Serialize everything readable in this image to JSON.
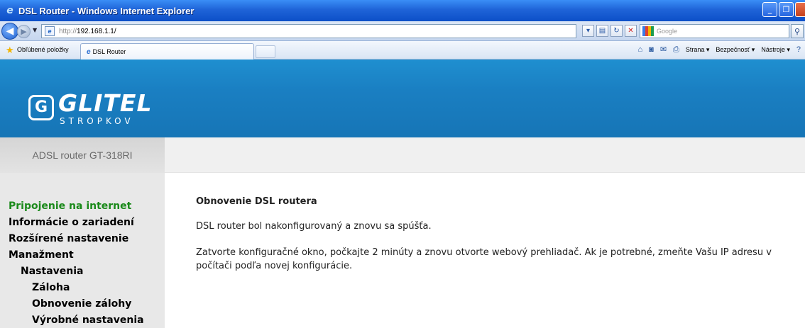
{
  "window": {
    "title": "DSL Router - Windows Internet Explorer"
  },
  "addressbar": {
    "url_protocol": "http://",
    "url_host": "192.168.1.1/",
    "search_placeholder": "Google"
  },
  "favbar": {
    "favorites_label": "Obľúbené položky",
    "tab_label": "DSL Router",
    "commands": [
      "Strana ▾",
      "Bezpečnosť ▾",
      "Nástroje ▾"
    ]
  },
  "banner": {
    "logo_mark": "G",
    "logo_text": "GLITEL",
    "logo_sub": "STROPKOV"
  },
  "model": {
    "label": "ADSL router GT-318RI"
  },
  "menu": {
    "items": [
      {
        "label": "Pripojenie na internet"
      },
      {
        "label": "Informácie o zariadení"
      },
      {
        "label": "Rozšírené nastavenie"
      },
      {
        "label": "Manažment"
      },
      {
        "label": "Nastavenia"
      },
      {
        "label": "Záloha"
      },
      {
        "label": "Obnovenie zálohy"
      },
      {
        "label": "Výrobné nastavenia"
      }
    ]
  },
  "main": {
    "heading": "Obnovenie DSL routera",
    "paragraph1": "DSL router bol nakonfigurovaný a znovu sa spúšťa.",
    "paragraph2": "Zatvorte konfiguračné okno, počkajte 2 minúty a znovu otvorte webový prehliadač. Ak je potrebné, zmeňte Vašu IP adresu v počítači podľa novej konfigurácie."
  },
  "colors": {
    "banner_blue": "#1a7fc2",
    "active_menu_green": "#1b8a1b"
  }
}
